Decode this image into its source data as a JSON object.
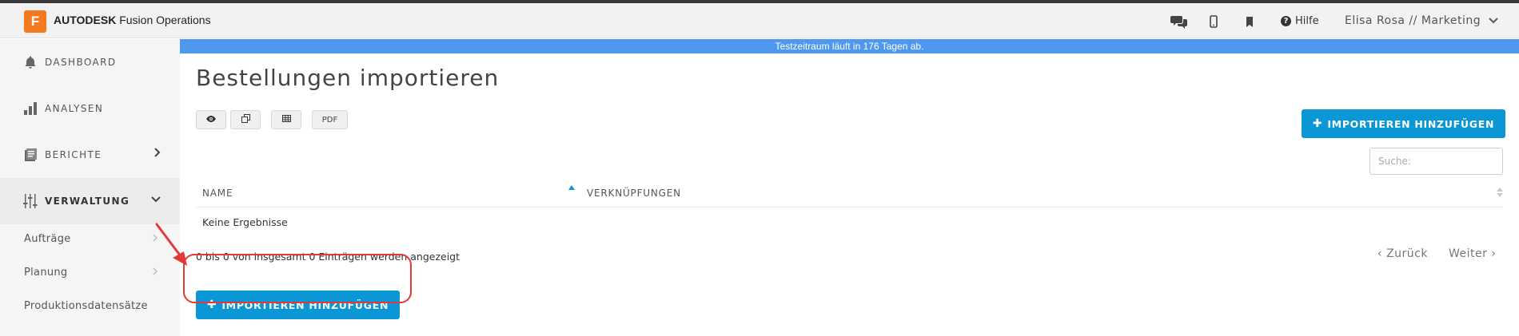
{
  "app": {
    "logo_letter": "F",
    "brand_bold": "AUTODESK",
    "brand_rest": "Fusion Operations",
    "brand_color": "#f47920"
  },
  "header": {
    "icons": [
      "chat-icon",
      "mobile-icon",
      "bookmark-icon"
    ],
    "help_label": "Hilfe",
    "user_label": "Elisa Rosa // Marketing"
  },
  "sidebar": {
    "items": [
      {
        "label": "DASHBOARD",
        "icon": "bell-icon"
      },
      {
        "label": "ANALYSEN",
        "icon": "bar-chart-icon"
      },
      {
        "label": "BERICHTE",
        "icon": "report-icon"
      },
      {
        "label": "VERWALTUNG",
        "icon": "sliders-icon"
      }
    ],
    "sub_items": [
      {
        "label": "Aufträge"
      },
      {
        "label": "Planung"
      },
      {
        "label": "Produktionsdatensätze"
      }
    ]
  },
  "main": {
    "trial_banner": "Testzeitraum läuft in 176 Tagen ab.",
    "title": "Bestellungen importieren",
    "toolbar": {
      "pdf_label": "PDF",
      "icons": [
        "eye-icon",
        "copy-icon",
        "table-icon"
      ]
    },
    "add_button_label": "IMPORTIEREN HINZUFÜGEN",
    "search_placeholder": "Suche:",
    "table": {
      "columns": [
        "NAME",
        "VERKNÜPFUNGEN"
      ],
      "empty_text": "Keine Ergebnisse"
    },
    "info_text": "0 bis 0 von insgesamt 0 Einträgen werden angezeigt",
    "pager": {
      "prev": "Zurück",
      "next": "Weiter"
    }
  },
  "colors": {
    "accent": "#0b96d6",
    "trial_banner": "#4e98f0",
    "annotation": "#e03a3a"
  }
}
